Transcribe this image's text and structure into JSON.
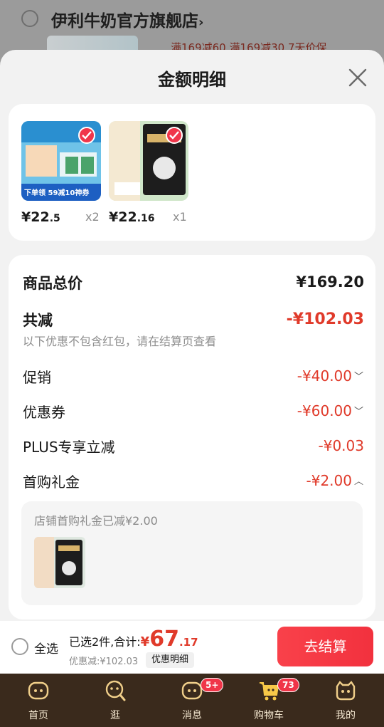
{
  "background": {
    "shop_name": "伊利牛奶官方旗舰店",
    "chevron": "›",
    "promo": "满169减60  满169减30  7天价保"
  },
  "sheet": {
    "title": "金额明细",
    "close_icon": "close-icon"
  },
  "items": [
    {
      "price_symbol": "¥",
      "price_int": "22",
      "price_dec": ".5",
      "qty": "x2",
      "thumb_promo": "下单领 59减10神券"
    },
    {
      "price_symbol": "¥",
      "price_int": "22",
      "price_dec": ".16",
      "qty": "x1"
    }
  ],
  "breakdown": {
    "total_label": "商品总价",
    "total_value": "¥169.20",
    "discount_label": "共减",
    "discount_value": "-¥102.03",
    "note": "以下优惠不包含红包，请在结算页查看",
    "rows": [
      {
        "label": "促销",
        "value": "-¥40.00",
        "chevron": "﹀"
      },
      {
        "label": "优惠券",
        "value": "-¥60.00",
        "chevron": "﹀"
      },
      {
        "label": "PLUS专享立减",
        "value": "-¥0.03",
        "chevron": ""
      },
      {
        "label": "首购礼金",
        "value": "-¥2.00",
        "chevron": "︿"
      }
    ],
    "sub_text": "店铺首购礼金已减¥2.00"
  },
  "checkout": {
    "select_all": "全选",
    "selected_text": "已选2件,合计:",
    "currency": "¥",
    "amount_int": "67",
    "amount_dec": ".17",
    "discount_text": "优惠减:¥102.03",
    "detail_chip": "优惠明细",
    "button": "去结算"
  },
  "tabs": [
    {
      "label": "首页",
      "icon": "home-icon"
    },
    {
      "label": "逛",
      "icon": "browse-icon"
    },
    {
      "label": "消息",
      "icon": "message-icon",
      "badge": "5+"
    },
    {
      "label": "购物车",
      "icon": "cart-icon",
      "badge": "73"
    },
    {
      "label": "我的",
      "icon": "profile-icon"
    }
  ],
  "colors": {
    "accent_red": "#e03a2a",
    "button_red": "#f2313e",
    "tabbar_bg": "#3a2a1c"
  }
}
